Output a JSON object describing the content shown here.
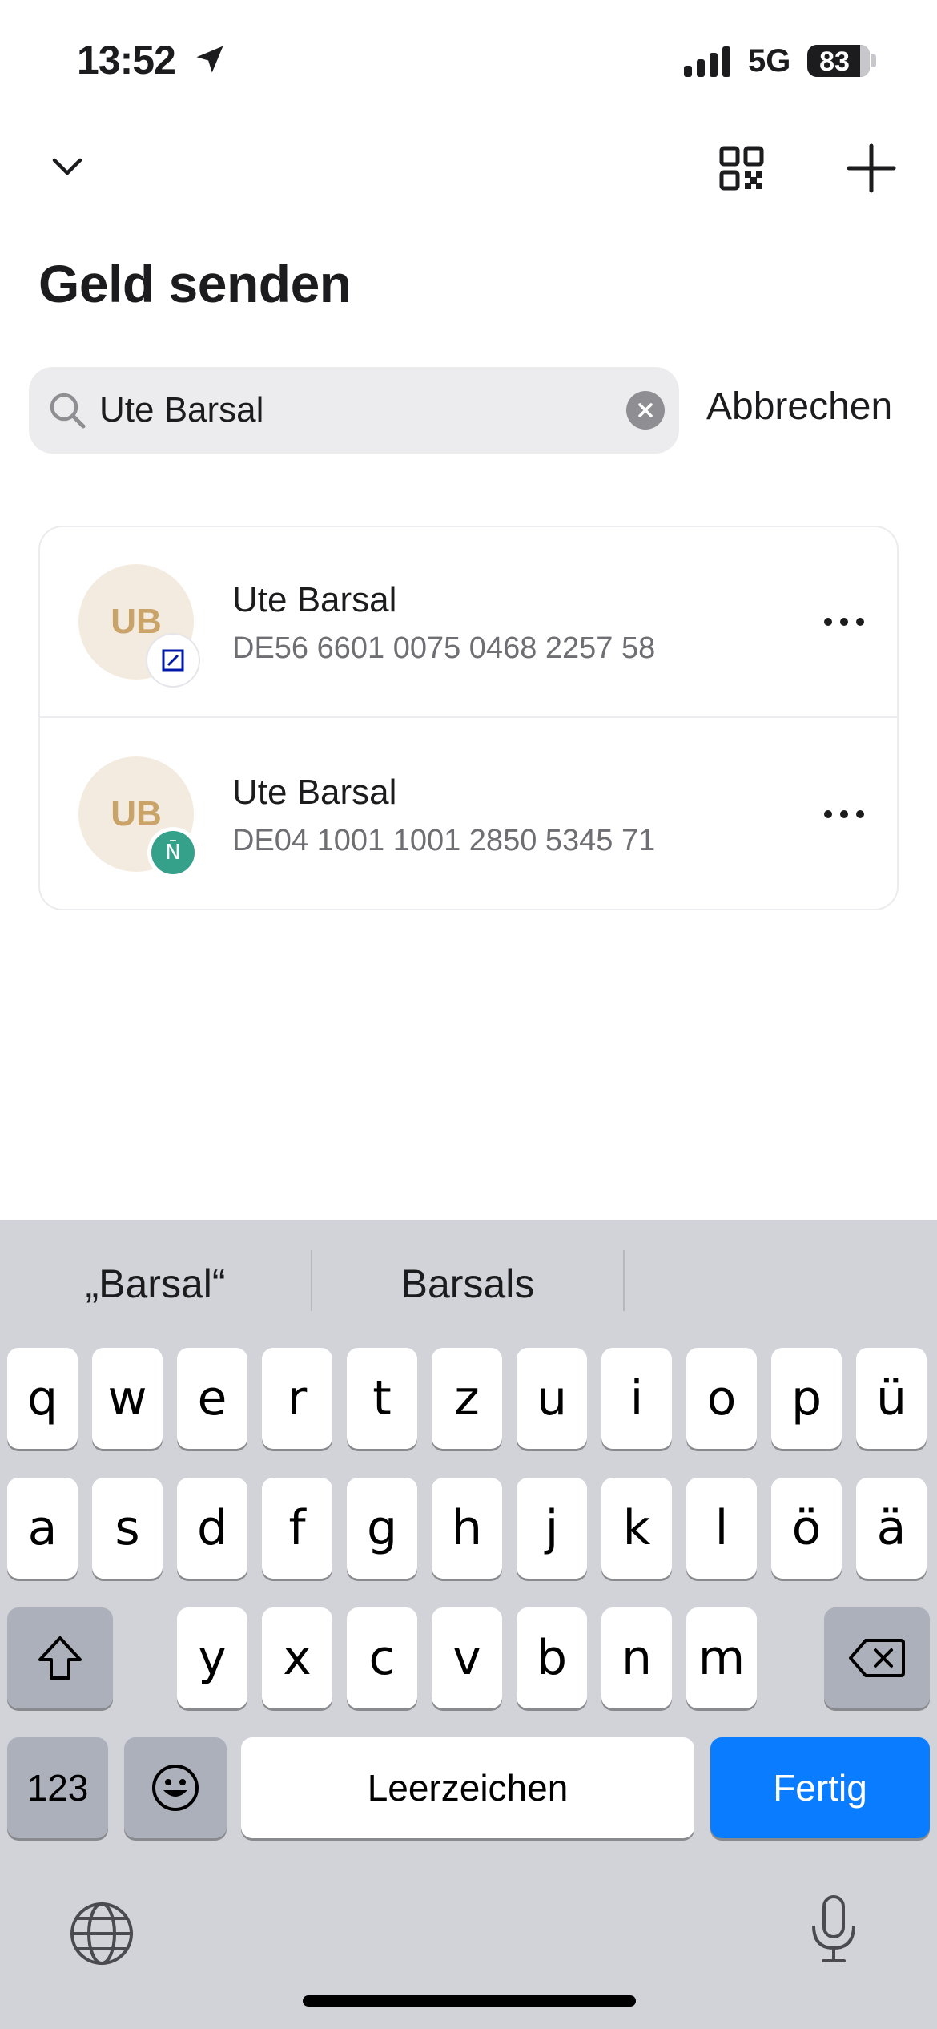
{
  "status_bar": {
    "time": "13:52",
    "network": "5G",
    "battery": "83",
    "icons": [
      "location-arrow-icon",
      "signal-icon",
      "battery-icon"
    ]
  },
  "nav": {
    "icons": [
      "chevron-down-icon",
      "qr-code-icon",
      "plus-icon"
    ]
  },
  "page": {
    "title": "Geld senden"
  },
  "search": {
    "value": "Ute Barsal",
    "cancel_label": "Abbrechen",
    "icon": "search-icon",
    "clear_icon": "clear-icon"
  },
  "results": [
    {
      "initials": "UB",
      "name": "Ute Barsal",
      "iban": "DE56 6601 0075 0468 2257 58",
      "bank_icon": "deutsche-bank-icon",
      "bank_badge_text": ""
    },
    {
      "initials": "UB",
      "name": "Ute Barsal",
      "iban": "DE04 1001 1001 2850 5345 71",
      "bank_icon": "n26-icon",
      "bank_badge_text": "N̄"
    }
  ],
  "keyboard": {
    "suggestions": [
      "„Barsal“",
      "Barsals",
      ""
    ],
    "row1": [
      "q",
      "w",
      "e",
      "r",
      "t",
      "z",
      "u",
      "i",
      "o",
      "p",
      "ü"
    ],
    "row2": [
      "a",
      "s",
      "d",
      "f",
      "g",
      "h",
      "j",
      "k",
      "l",
      "ö",
      "ä"
    ],
    "row3": [
      "y",
      "x",
      "c",
      "v",
      "b",
      "n",
      "m"
    ],
    "numbers_label": "123",
    "space_label": "Leerzeichen",
    "return_label": "Fertig",
    "icons": [
      "shift-icon",
      "backspace-icon",
      "emoji-icon",
      "globe-icon",
      "microphone-icon"
    ]
  },
  "colors": {
    "accent": "#0a7cff",
    "avatar_bg": "#f3ebe0",
    "avatar_text": "#c9a367",
    "n26_green": "#36a18b",
    "keyboard_bg": "#d1d3d9"
  }
}
